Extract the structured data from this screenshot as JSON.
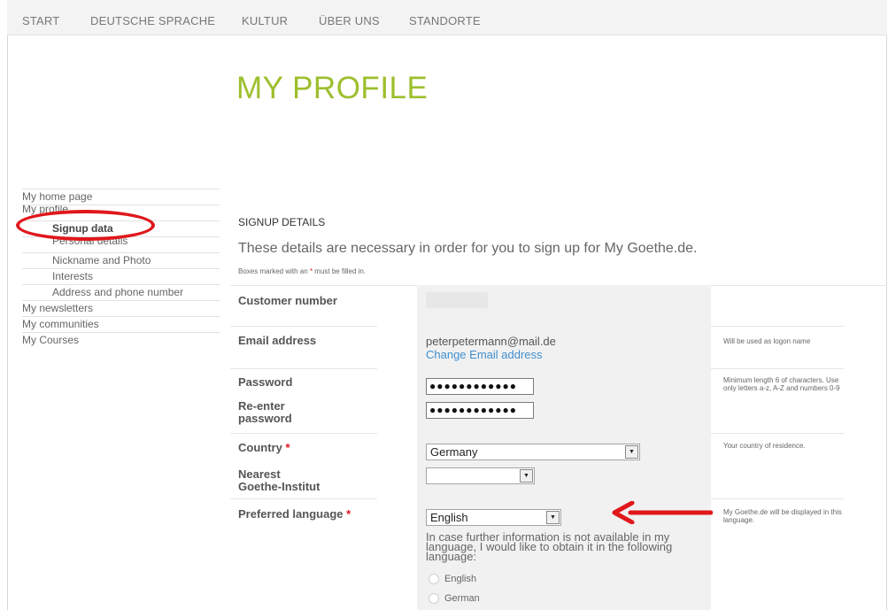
{
  "topnav": [
    "START",
    "DEUTSCHE SPRACHE",
    "KULTUR",
    "ÜBER UNS",
    "STANDORTE"
  ],
  "page_title": "MY PROFILE",
  "sidebar": {
    "home": "My home page",
    "profile": "My profile",
    "signup": "Signup data",
    "personal": "Personal details",
    "nickname": "Nickname and Photo",
    "interests": "Interests",
    "address": "Address and phone number",
    "newsletters": "My newsletters",
    "communities": "My communities",
    "courses": "My Courses"
  },
  "section": {
    "title": "SIGNUP DETAILS",
    "description": "These details are necessary in order for you to sign up for My Goethe.de.",
    "required_note_a": "Boxes marked with an ",
    "required_note_star": "*",
    "required_note_b": " must be filled in."
  },
  "form": {
    "customer_number_label": "Customer number",
    "email_label": "Email address",
    "email_value": "peterpetermann@mail.de",
    "change_email": "Change Email address",
    "email_help": "Will be used as logon name",
    "password_label": "Password",
    "password_value": "●●●●●●●●●●●●",
    "reenter_label_1": "Re-enter",
    "reenter_label_2": "password",
    "reenter_value": "●●●●●●●●●●●●",
    "password_help": "Minimum length 6 of characters. Use only letters a-z, A-Z and numbers 0-9",
    "country_label": "Country",
    "country_value": "Germany",
    "country_help": "Your country of residence.",
    "institut_label_1": "Nearest",
    "institut_label_2": "Goethe-Institut",
    "institut_value": "",
    "language_label": "Preferred language",
    "language_value": "English",
    "language_help": "My Goethe.de will be displayed in this language.",
    "fallback_text": "In case further information is not available in my language, I would like to obtain it in the following language:",
    "fallback_options": [
      "English",
      "German"
    ],
    "required_star": "*"
  },
  "colors": {
    "title_green": "#9dbf2d",
    "annotation_red": "#e0171b",
    "link_blue": "#3f8fcf"
  }
}
